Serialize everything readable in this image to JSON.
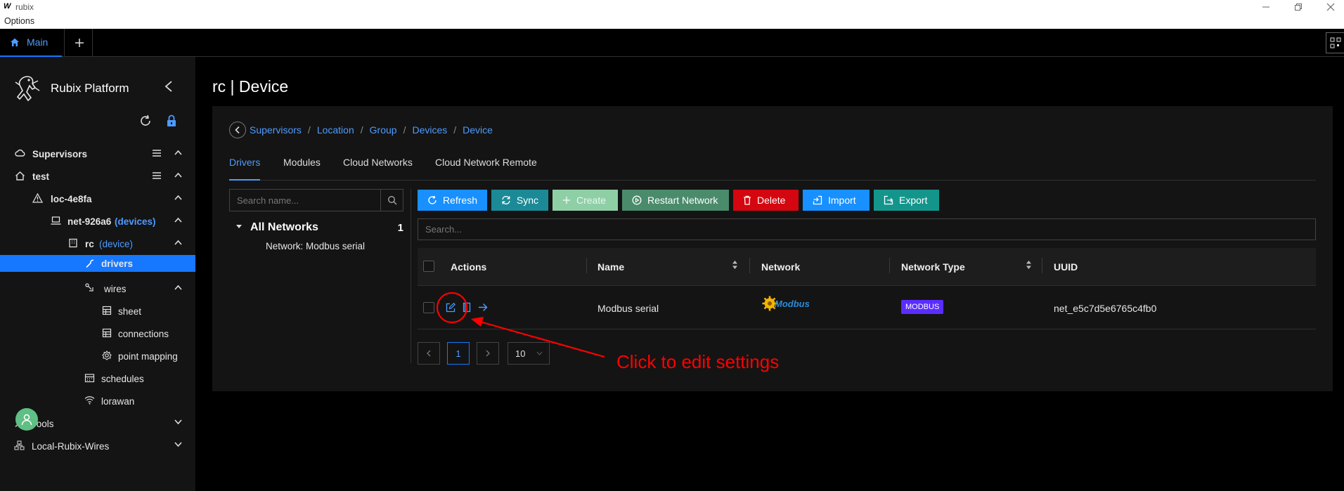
{
  "window": {
    "logo_letter": "W",
    "title": "rubix",
    "menu": [
      "Options"
    ]
  },
  "tabstrip": {
    "main_label": "Main",
    "add_symbol": "+"
  },
  "sidebar": {
    "brand": "Rubix Platform",
    "items": [
      {
        "label": "Supervisors",
        "icon": "cloud-icon"
      },
      {
        "label": "test",
        "icon": "home-icon"
      },
      {
        "label": "loc-4e8fa",
        "icon": "warning-icon"
      },
      {
        "label": "net-926a6",
        "suffix": "(devices)",
        "icon": "laptop-icon"
      },
      {
        "label": "rc",
        "suffix": "(device)",
        "icon": "building-icon"
      },
      {
        "label": "drivers",
        "icon": "wrench-icon"
      },
      {
        "label": "wires",
        "icon": "link-icon"
      },
      {
        "label": "sheet",
        "icon": "grid-icon"
      },
      {
        "label": "connections",
        "icon": "grid-icon"
      },
      {
        "label": "point mapping",
        "icon": "gear-icon"
      },
      {
        "label": "schedules",
        "icon": "calendar-icon"
      },
      {
        "label": "lorawan",
        "icon": "wifi-icon"
      },
      {
        "label": "Tools",
        "icon": "tool-icon"
      },
      {
        "label": "Local-Rubix-Wires",
        "icon": "network-icon"
      }
    ]
  },
  "main": {
    "title": "rc | Device",
    "breadcrumb": [
      "Supervisors",
      "Location",
      "Group",
      "Devices",
      "Device"
    ],
    "breadcrumb_sep": "/",
    "tabs": [
      "Drivers",
      "Modules",
      "Cloud Networks",
      "Cloud Network Remote"
    ],
    "tree": {
      "search_placeholder": "Search name...",
      "root_label": "All Networks",
      "root_count": "1",
      "child": "Network: Modbus serial"
    },
    "toolbar": {
      "refresh": "Refresh",
      "sync": "Sync",
      "create": "Create",
      "restart": "Restart Network",
      "delete": "Delete",
      "import": "Import",
      "export": "Export"
    },
    "table": {
      "search_placeholder": "Search...",
      "columns": [
        "Actions",
        "Name",
        "Network",
        "Network Type",
        "UUID"
      ],
      "rows": [
        {
          "name": "Modbus serial",
          "network_logo": "Modbus",
          "network_type": "MODBUS",
          "uuid": "net_e5c7d5e6765c4fb0"
        }
      ]
    },
    "pagination": {
      "current": "1",
      "page_size": "10"
    }
  },
  "annotation": {
    "text": "Click to edit settings",
    "color": "#ff0000"
  },
  "colors": {
    "accent": "#1677ff",
    "sidebar_bg": "#141414",
    "panel_bg": "#141414",
    "tag_bg": "#5a2dff"
  }
}
